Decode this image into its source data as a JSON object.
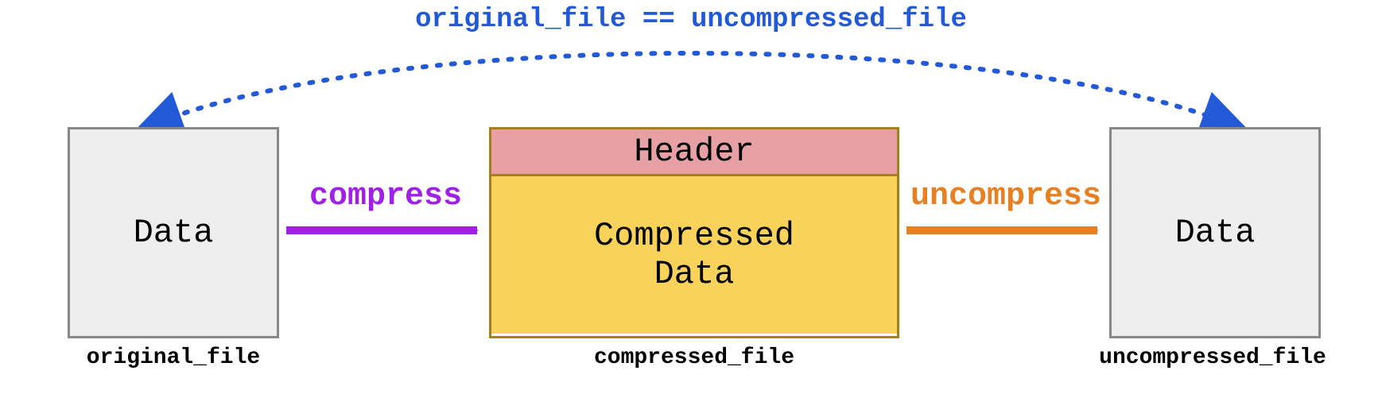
{
  "equivalence": {
    "label": "original_file == uncompressed_file",
    "color": "#2259d6"
  },
  "boxes": {
    "original": {
      "content": "Data",
      "label": "original_file"
    },
    "compressed": {
      "header": "Header",
      "content": "Compressed\nData",
      "label": "compressed_file"
    },
    "uncompressed": {
      "content": "Data",
      "label": "uncompressed_file"
    }
  },
  "arrows": {
    "compress": {
      "label": "compress",
      "color": "#a020e8"
    },
    "uncompress": {
      "label": "uncompress",
      "color": "#e87f20"
    }
  },
  "colors": {
    "box_border": "#888888",
    "box_fill": "#eeeeee",
    "comp_border": "#a57f1c",
    "header_fill": "#e7a0a4",
    "body_fill": "#f9d25b"
  }
}
